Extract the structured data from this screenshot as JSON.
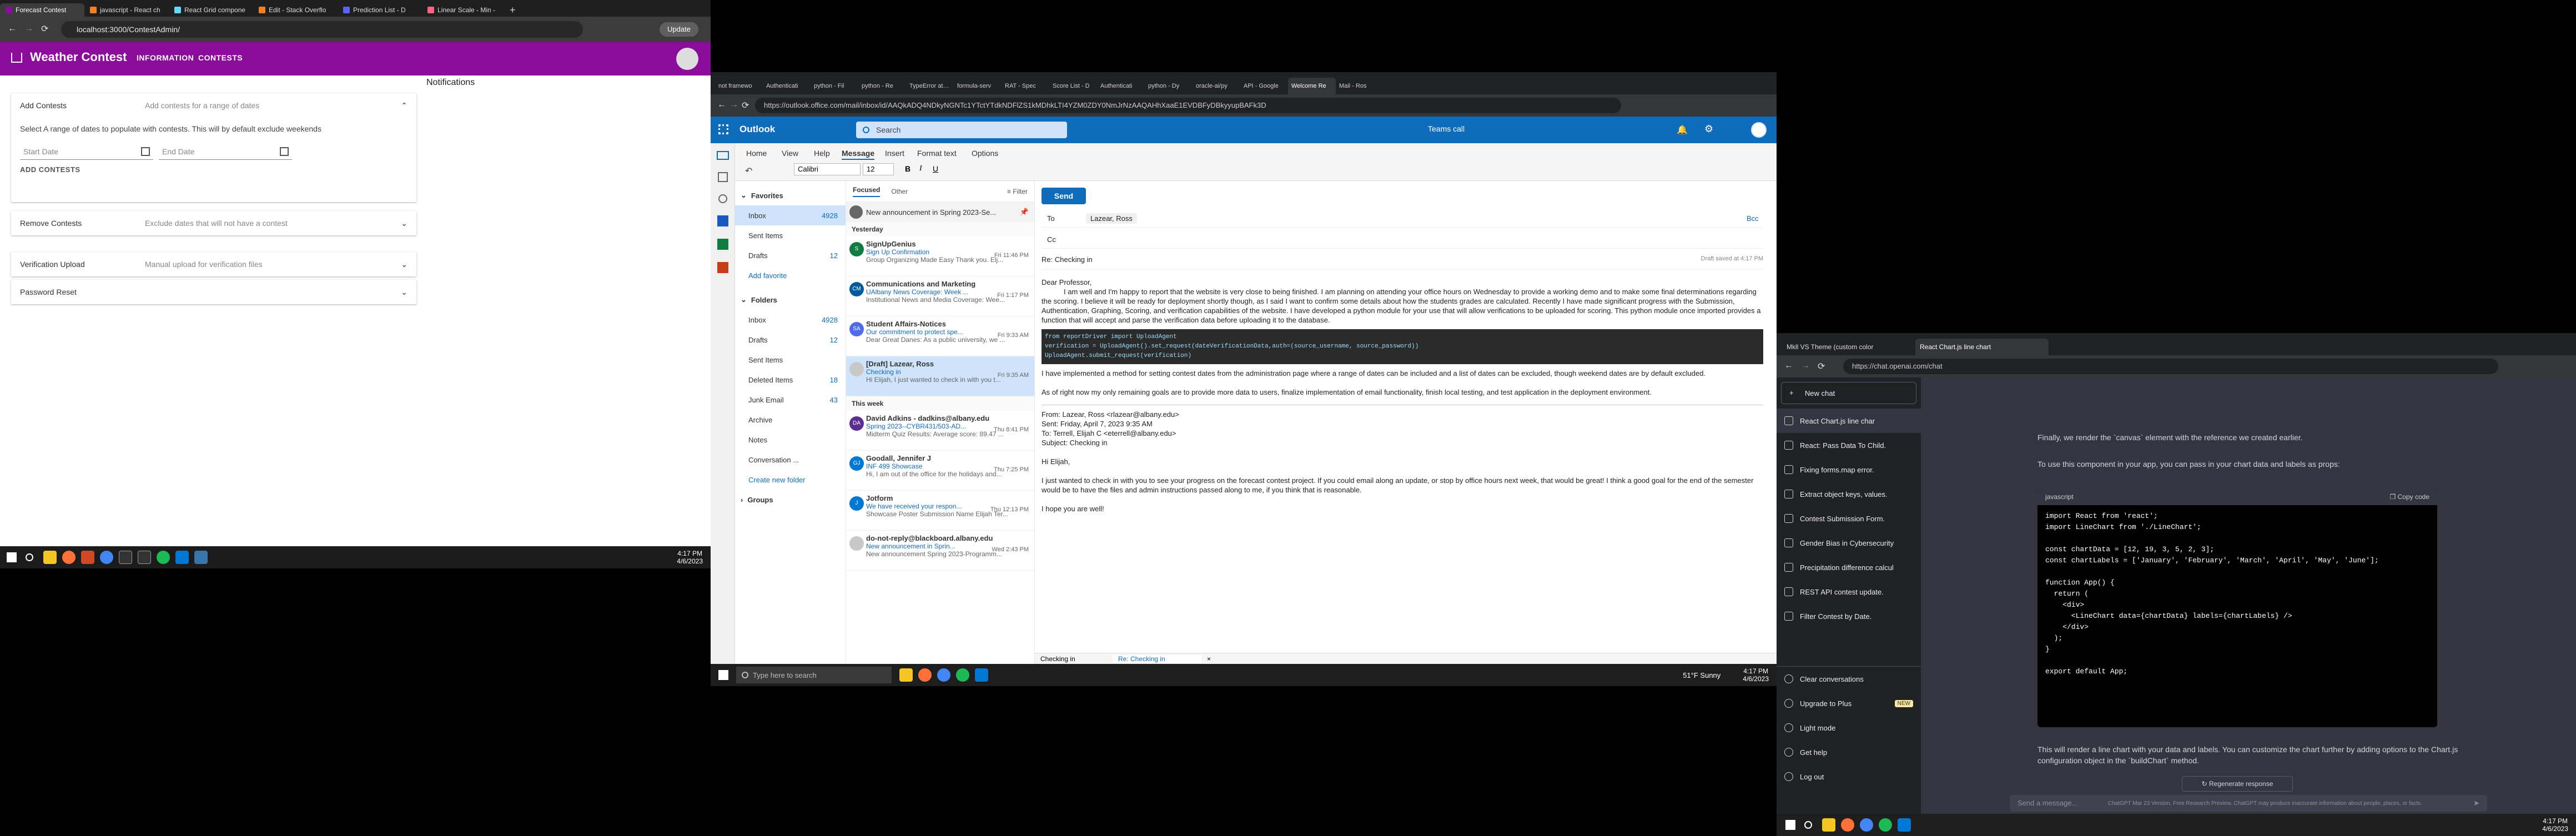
{
  "monitor1": {
    "tabs": [
      "Forecast Contest",
      "javascript - React ch",
      "React Grid compone",
      "Edit - Stack Overflo",
      "Prediction List - D",
      "Linear Scale - Min -"
    ],
    "url": "localhost:3000/ContestAdmin/",
    "update_label": "Update",
    "app_title": "Weather Contest",
    "nav": [
      "INFORMATION",
      "CONTESTS"
    ],
    "notifications_label": "Notifications",
    "add_contests": {
      "title": "Add Contests",
      "subtitle": "Add contests for a range of dates",
      "description": "Select A range of dates to populate with contests. This will by default exclude weekends",
      "start_placeholder": "Start Date",
      "end_placeholder": "End Date",
      "button": "ADD CONTESTS"
    },
    "panels": [
      {
        "title": "Remove Contests",
        "subtitle": "Exclude dates that will not have a contest"
      },
      {
        "title": "Verification Upload",
        "subtitle": "Manual upload for verification files"
      },
      {
        "title": "Password Reset",
        "subtitle": ""
      }
    ],
    "clock": {
      "time": "4:17 PM",
      "date": "4/6/2023"
    }
  },
  "monitor2": {
    "tabs": [
      "not framewo",
      "Authenticati",
      "python - Fil",
      "python - Re",
      "TypeError at /api",
      "formula-serv",
      "RAT - Spec",
      "Score List - D",
      "Authenticati",
      "python - Dy",
      "oracle-ai/py",
      "API - Google",
      "Welcome Re",
      "Mail - Ros"
    ],
    "url": "https://outlook.office.com/mail/inbox/id/AAQkADQ4NDkyNGNTc1YTctYTdkNDFlZS1kMDhkLTI4YZM0ZDY0NmJrNzAAQAHhXaaE1EVDBFyDBkyyupBAFk3D",
    "app": "Outlook",
    "search_placeholder": "Search",
    "teams_call": "Teams call",
    "ribbon_tabs": [
      "Home",
      "View",
      "Help",
      "Message",
      "Insert",
      "Format text",
      "Options"
    ],
    "font": "Calibri",
    "font_size": "12",
    "favorites_label": "Favorites",
    "favorites": [
      {
        "name": "Inbox",
        "count": "4928"
      },
      {
        "name": "Sent Items",
        "count": ""
      },
      {
        "name": "Drafts",
        "count": "12"
      }
    ],
    "add_favorite": "Add favorite",
    "folders_label": "Folders",
    "folders": [
      {
        "name": "Inbox",
        "count": "4928"
      },
      {
        "name": "Drafts",
        "count": "12"
      },
      {
        "name": "Sent Items",
        "count": ""
      },
      {
        "name": "Deleted Items",
        "count": "18"
      },
      {
        "name": "Junk Email",
        "count": "43"
      },
      {
        "name": "Archive",
        "count": ""
      },
      {
        "name": "Notes",
        "count": ""
      },
      {
        "name": "Conversation ...",
        "count": ""
      }
    ],
    "create_folder": "Create new folder",
    "groups_label": "Groups",
    "list_tabs": [
      "Focused",
      "Other"
    ],
    "filter_label": "Filter",
    "pinned": "New announcement in Spring 2023-Se...",
    "section_yesterday": "Yesterday",
    "section_week": "This week",
    "messages": [
      {
        "av": "S",
        "color": "#107c41",
        "sender": "SignUpGenius",
        "subject": "Sign Up Confirmation",
        "preview": "Group Organizing Made Easy Thank you. Elj...",
        "time": "Fri 11:46 PM"
      },
      {
        "av": "CM",
        "color": "#005a9e",
        "sender": "Communications and Marketing",
        "subject": "UAlbany News Coverage: Week ...",
        "preview": "Institutional News and Media Coverage: Wee...",
        "time": "Fri 1:17 PM"
      },
      {
        "av": "SA",
        "color": "#4f6bed",
        "sender": "Student Affairs-Notices",
        "subject": "Our commitment to protect spe...",
        "preview": "Dear Great Danes: As a public university, we ...",
        "time": "Fri 9:33 AM"
      },
      {
        "av": "",
        "color": "#c8c8c8",
        "sender": "[Draft] Lazear, Ross",
        "subject": "Checking in",
        "preview": "Hi Elijah, I just wanted to check in with you t...",
        "time": "Fri 9:35 AM"
      },
      {
        "av": "DA",
        "color": "#5c2e91",
        "sender": "David Adkins - dadkins@albany.edu",
        "subject": "Spring 2023--CYBR431/503-AD...",
        "preview": "Midterm Quiz Results: Average score: 89.47 ...",
        "time": "Thu 8:41 PM"
      },
      {
        "av": "GJ",
        "color": "#0078d4",
        "sender": "Goodall, Jennifer J",
        "subject": "INF 499 Showcase",
        "preview": "Hi, I am out of the office for the holidays and...",
        "time": "Thu 7:25 PM"
      },
      {
        "av": "J",
        "color": "#0078d4",
        "sender": "Jotform",
        "subject": "We have received your respon...",
        "preview": "Showcase Poster Submission Name Elijah Ter...",
        "time": "Thu 12:13 PM"
      },
      {
        "av": "",
        "color": "#c8c8c8",
        "sender": "do-not-reply@blackboard.albany.edu",
        "subject": "New announcement in Sprin...",
        "preview": "New announcement Spring 2023-Programm...",
        "time": "Wed 2:43 PM"
      }
    ],
    "compose": {
      "send": "Send",
      "to_label": "To",
      "to_value": "Lazear, Ross",
      "cc_label": "Cc",
      "bcc": "Bcc",
      "subject": "Re: Checking in",
      "draft_saved": "Draft saved at 4:17 PM",
      "greeting": "Dear Professor,",
      "p1": "I am well and I'm happy to report that the website is very close to being finished. I am planning on attending your office hours on Wednesday to provide a working demo and to make some final determinations regarding the scoring. I believe it will be ready for deployment shortly though, as I said I want to confirm some details about how the students grades are calculated. Recently I have made significant progress with the Submission, Authentication, Graphing, Scoring, and verification capabilities of the website. I have developed a python module for your use that will allow verifications to be uploaded for scoring. This python module once imported provides a function that will accept and parse the verification data before uploading it to the database.",
      "code": [
        "from reportDriver import UploadAgent",
        "verification = UploadAgent().set_request(dateVerificationData,auth=(source_username, source_password))",
        "UploadAgent.submit_request(verification)"
      ],
      "p2": "I have implemented a method for setting contest dates from the administration page where a range of dates can be included and a list of dates can be excluded, though weekend dates are by default excluded.",
      "p3": "As of right now my only remaining goals are to provide more data to users, finalize implementation of email functionality, finish local testing, and test application in the deployment environment.",
      "from": "From: Lazear, Ross <rlazear@albany.edu>",
      "sent": "Sent: Friday, April 7, 2023 9:35 AM",
      "to": "To: Terrell, Elijah C <eterrell@albany.edu>",
      "subj": "Subject: Checking in",
      "hi": "Hi Elijah,",
      "q1": "I just wanted to check in with you to see your progress on the forecast contest project.  If you could email along an update, or stop by office hours next week, that would be great!  I think a good goal for the end of the semester would be to have the files and admin instructions passed along to me, if you think that is reasonable.",
      "q2": "I hope you are well!"
    },
    "bottom_tabs": [
      "Checking in",
      "Re: Checking in"
    ],
    "taskbar_search": "Type here to search",
    "weather": "51°F  Sunny",
    "clock": {
      "time": "4:17 PM",
      "date": "4/6/2023"
    }
  },
  "monitor3": {
    "tabs": [
      "Mkll VS Theme (custom color",
      "React Chart.js line chart"
    ],
    "url": "https://chat.openai.com/chat",
    "new_chat": "New chat",
    "history": [
      "React Chart.js line char",
      "React: Pass Data To Child.",
      "Fixing forms.map error.",
      "Extract object keys, values.",
      "Contest Submission Form.",
      "Gender Bias in Cybersecurity",
      "Precipitation difference calcul",
      "REST API contest update.",
      "Filter Contest by Date."
    ],
    "bottom_items": [
      "Clear conversations",
      "Upgrade to Plus",
      "Light mode",
      "Get help",
      "Log out"
    ],
    "new_badge": "NEW",
    "intro1": "Finally, we render the `canvas` element with the reference we created earlier.",
    "intro2": "To use this component in your app, you can pass in your chart data and labels as props:",
    "code_lang": "javascript",
    "copy_code": "Copy code",
    "code": [
      "import React from 'react';",
      "import LineChart from './LineChart';",
      "",
      "const chartData = [12, 19, 3, 5, 2, 3];",
      "const chartLabels = ['January', 'February', 'March', 'April', 'May', 'June'];",
      "",
      "function App() {",
      "  return (",
      "    <div>",
      "      <LineChart data={chartData} labels={chartLabels} />",
      "    </div>",
      "  );",
      "}",
      "",
      "export default App;"
    ],
    "outro": "This will render a line chart with your data and labels. You can customize the chart further by adding options to the Chart.js configuration object in the `buildChart` method.",
    "regenerate": "Regenerate response",
    "input_placeholder": "Send a message...",
    "footer": "ChatGPT Mar 23 Version. Free Research Preview. ChatGPT may produce inaccurate information about people, places, or facts.",
    "clock": {
      "time": "4:17 PM",
      "date": "4/6/2023"
    }
  },
  "colors": {
    "contest_purple": "#8b0b9b",
    "outlook_blue": "#0f6cbd",
    "chatgpt_bg": "#343541",
    "chatgpt_sidebar": "#202123"
  }
}
